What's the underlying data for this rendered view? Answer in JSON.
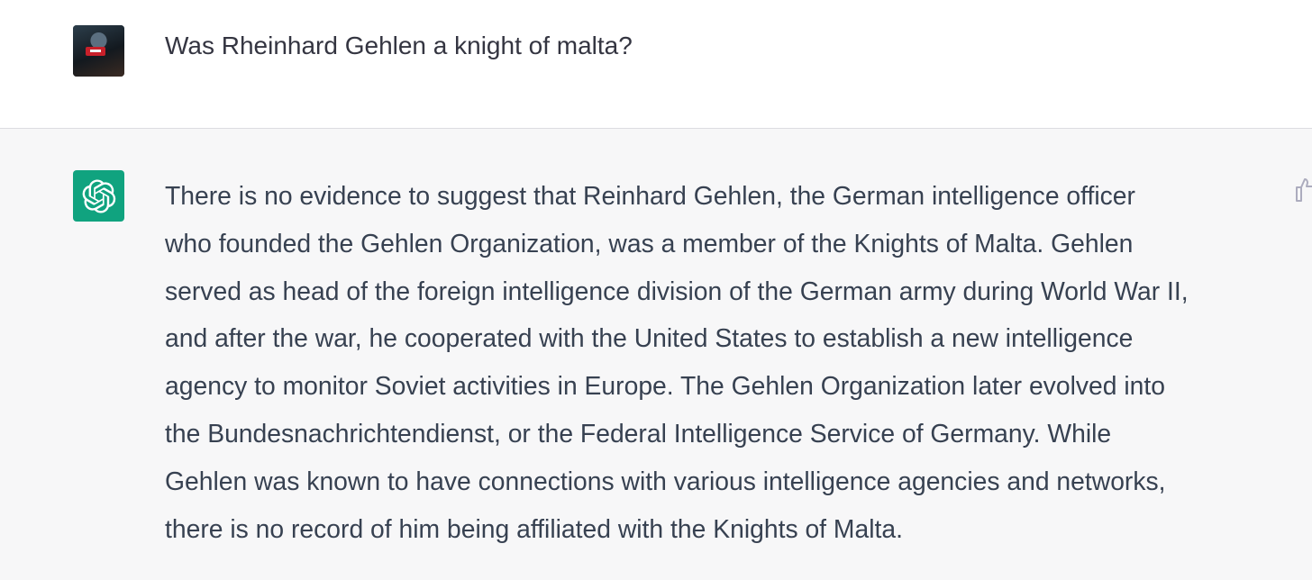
{
  "conversation": {
    "user_message": {
      "avatar_icon": "user-avatar-photo",
      "text": "Was Rheinhard Gehlen a knight of malta?"
    },
    "assistant_message": {
      "avatar_icon": "openai-logo-icon",
      "accent_color": "#10a37f",
      "lines": [
        "There is no evidence to suggest that Reinhard Gehlen, the German intelligence officer",
        "who founded the Gehlen Organization, was a member of the Knights of Malta. Gehlen",
        "served as head of the foreign intelligence division of the German army during World War II,",
        "and after the war, he cooperated with the United States to establish a new intelligence",
        "agency to monitor Soviet activities in Europe. The Gehlen Organization later evolved into",
        "the Bundesnachrichtendienst, or the Federal Intelligence Service of Germany. While",
        "Gehlen was known to have connections with various intelligence agencies and networks,",
        "there is no record of him being affiliated with the Knights of Malta."
      ],
      "feedback_icon": "thumbs-up-icon"
    }
  },
  "colors": {
    "user_row_bg": "#ffffff",
    "assistant_row_bg": "#f7f7f8",
    "text": "#343541"
  }
}
